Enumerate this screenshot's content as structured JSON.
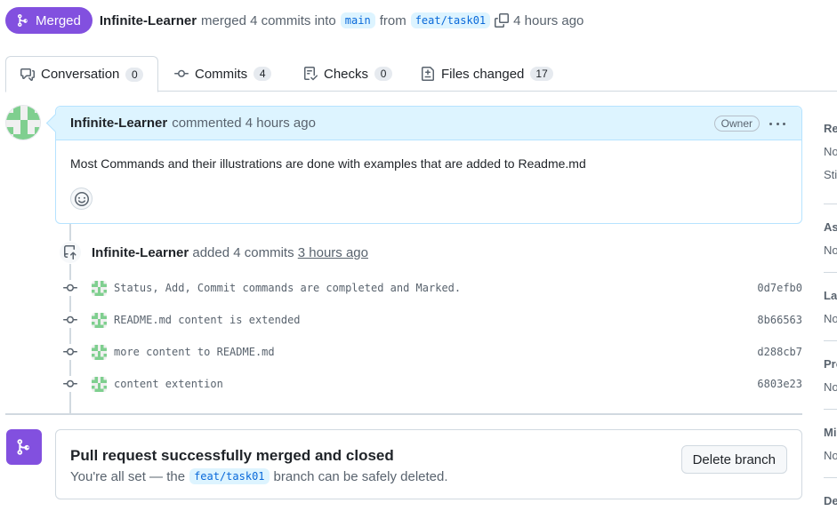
{
  "header": {
    "state_label": "Merged",
    "author": "Infinite-Learner",
    "action_text": "merged 4 commits into",
    "base_branch": "main",
    "from_text": "from",
    "head_branch": "feat/task01",
    "time": "4 hours ago"
  },
  "tabs": [
    {
      "label": "Conversation",
      "count": "0",
      "icon": "comment-discussion-icon"
    },
    {
      "label": "Commits",
      "count": "4",
      "icon": "git-commit-icon"
    },
    {
      "label": "Checks",
      "count": "0",
      "icon": "checklist-icon"
    },
    {
      "label": "Files changed",
      "count": "17",
      "icon": "file-diff-icon"
    }
  ],
  "comment": {
    "author": "Infinite-Learner",
    "meta": "commented 4 hours ago",
    "role_badge": "Owner",
    "body": "Most Commands and their illustrations are done with examples that are added to Readme.md"
  },
  "commit_event": {
    "author": "Infinite-Learner",
    "text": "added 4 commits",
    "time": "3 hours ago"
  },
  "commits": [
    {
      "message": "Status, Add, Commit commands are completed and Marked.",
      "sha": "0d7efb0"
    },
    {
      "message": "README.md content is extended",
      "sha": "8b66563"
    },
    {
      "message": "more content to README.md",
      "sha": "d288cb7"
    },
    {
      "message": "content extention",
      "sha": "6803e23"
    }
  ],
  "merge_box": {
    "title": "Pull request successfully merged and closed",
    "sub_before": "You're all set — the",
    "branch": "feat/task01",
    "sub_after": "branch can be safely deleted.",
    "delete_label": "Delete branch"
  },
  "sidebar": {
    "sections": [
      {
        "heading": "Re",
        "values": [
          "No",
          "Sti"
        ]
      },
      {
        "heading": "Ass",
        "values": [
          "No"
        ]
      },
      {
        "heading": "Lab",
        "values": [
          "No"
        ]
      },
      {
        "heading": "Pro",
        "values": [
          "No"
        ]
      },
      {
        "heading": "Mil",
        "values": [
          "No"
        ]
      },
      {
        "heading": "De",
        "values": []
      }
    ]
  },
  "colors": {
    "merged_purple": "#8250df",
    "link_blue": "#0969da",
    "comment_header_bg": "#ddf4ff"
  }
}
